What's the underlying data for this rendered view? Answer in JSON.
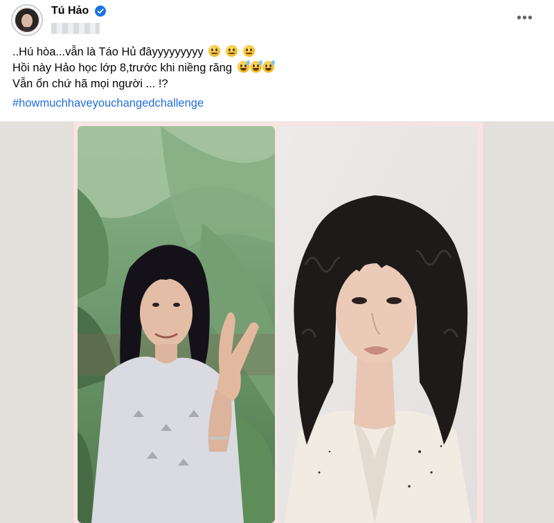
{
  "post": {
    "author_name": "Tú Hảo",
    "verified": true,
    "lines": [
      "..Hú hòa...vẫn là Táo Hủ đâyyyyyyyyy",
      "Hồi này Hảo học lớp 8,trước khi niềng răng",
      "Vẫn ổn chứ hã mọi người ... !?"
    ],
    "hashtag": "#howmuchhaveyouchangedchallenge"
  },
  "icons": {
    "verified": "verified-badge-icon",
    "more": "more-options-icon",
    "emoji_line1": "slightly-smiling-face-emoji",
    "emoji_line2": "grinning-sweat-face-emoji"
  },
  "photos": [
    {
      "name": "then-photo",
      "subject": "girl in school t-shirt making peace sign in front of banana leaves"
    },
    {
      "name": "now-photo",
      "subject": "woman with curly bangs in cream blazer, studio portrait"
    }
  ],
  "colors": {
    "hashtag": "#216fdb",
    "verified": "#1b74e4",
    "backdrop": "#e3e0db",
    "frame": "#f7e4e2"
  }
}
